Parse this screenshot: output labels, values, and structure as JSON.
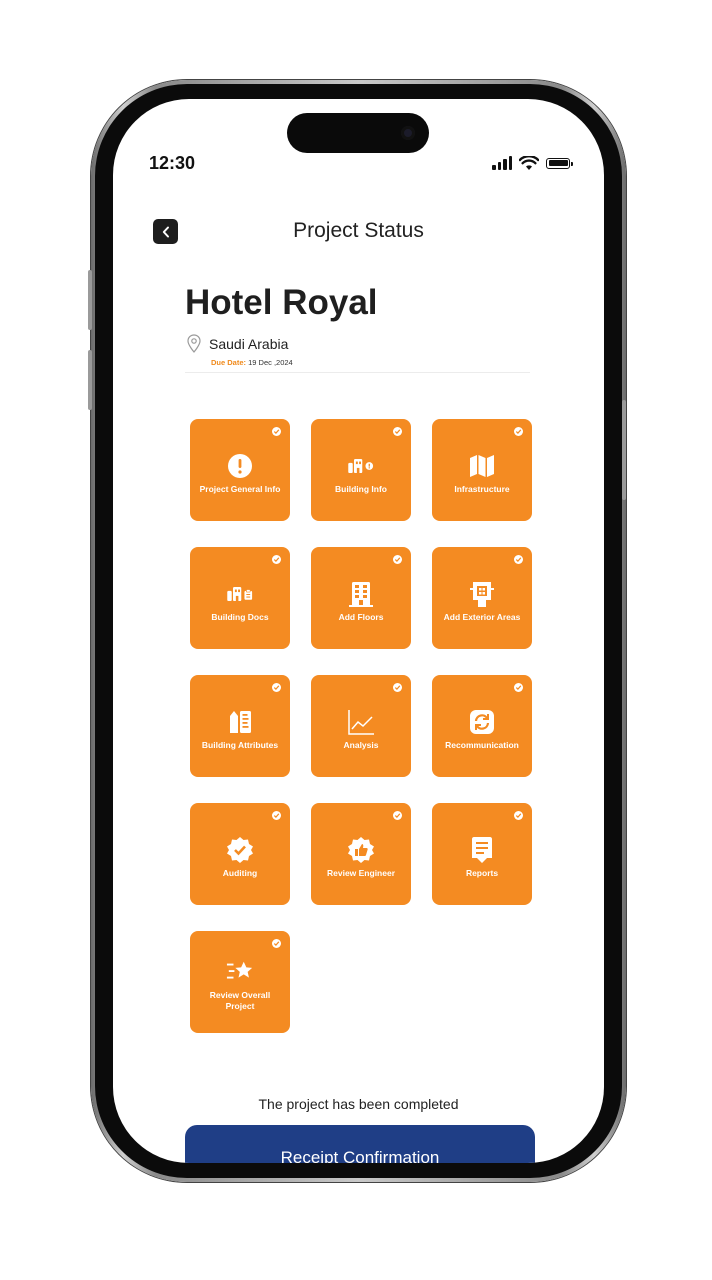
{
  "status_bar": {
    "time": "12:30"
  },
  "header": {
    "title": "Project Status"
  },
  "project": {
    "name": "Hotel Royal",
    "location": "Saudi Arabia",
    "due_label": "Due Date:",
    "due_value": "19 Dec ,2024"
  },
  "tiles": [
    {
      "label": "Project General Info",
      "icon": "info-circle-icon",
      "completed": true
    },
    {
      "label": "Building Info",
      "icon": "buildings-info-icon",
      "completed": true
    },
    {
      "label": "Infrastructure",
      "icon": "map-icon",
      "completed": true
    },
    {
      "label": "Building Docs",
      "icon": "building-docs-icon",
      "completed": true
    },
    {
      "label": "Add Floors",
      "icon": "floors-building-icon",
      "completed": true
    },
    {
      "label": "Add Exterior Areas",
      "icon": "exterior-building-icon",
      "completed": true
    },
    {
      "label": "Building Attributes",
      "icon": "attributes-icon",
      "completed": true
    },
    {
      "label": "Analysis",
      "icon": "line-chart-icon",
      "completed": true
    },
    {
      "label": "Recommunication",
      "icon": "refresh-icon",
      "completed": true
    },
    {
      "label": "Auditing",
      "icon": "verified-badge-icon",
      "completed": true
    },
    {
      "label": "Review Engineer",
      "icon": "thumbs-up-badge-icon",
      "completed": true
    },
    {
      "label": "Reports",
      "icon": "report-icon",
      "completed": true
    },
    {
      "label": "Review Overall Project",
      "icon": "star-rating-icon",
      "completed": true
    }
  ],
  "footer": {
    "status_message": "The project has been completed",
    "confirm_button": "Receipt Confirmation"
  },
  "colors": {
    "tile": "#f48b22",
    "button": "#1f3e86",
    "due_label": "#f08a1c"
  }
}
